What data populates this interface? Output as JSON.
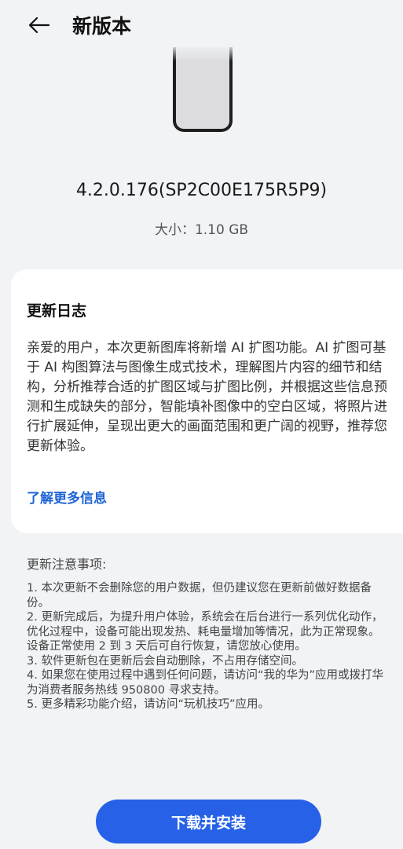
{
  "header": {
    "back_icon": "back-arrow-icon",
    "title": "新版本"
  },
  "update": {
    "version": "4.2.0.176(SP2C00E175R5P9)",
    "size": "大小：1.10 GB"
  },
  "changelog": {
    "title": "更新日志",
    "body": "亲爱的用户，本次更新图库将新增 AI 扩图功能。AI 扩图可基于 AI 构图算法与图像生成式技术，理解图片内容的细节和结构，分析推荐合适的扩图区域与扩图比例，并根据这些信息预测和生成缺失的部分，智能填补图像中的空白区域，将照片进行扩展延伸，呈现出更大的画面范围和更广阔的视野，推荐您更新体验。",
    "more_link": "了解更多信息"
  },
  "notes": {
    "title": "更新注意事项:",
    "items": [
      "1. 本次更新不会删除您的用户数据，但仍建议您在更新前做好数据备份。",
      "2. 更新完成后，为提升用户体验，系统会在后台进行一系列优化动作，优化过程中，设备可能出现发热、耗电量增加等情况，此为正常现象。设备正常使用 2 到 3 天后可自行恢复，请您放心使用。",
      "3. 软件更新包在更新后会自动删除，不占用存储空间。",
      "4. 如果您在使用过程中遇到任何问题，请访问“我的华为”应用或拨打华为消费者服务热线 950800 寻求支持。",
      "5. 更多精彩功能介绍，请访问“玩机技巧”应用。"
    ]
  },
  "actions": {
    "install_label": "下载并安装"
  },
  "colors": {
    "accent": "#2661e8",
    "link": "#1e63d6",
    "background": "#f1f3f5"
  }
}
